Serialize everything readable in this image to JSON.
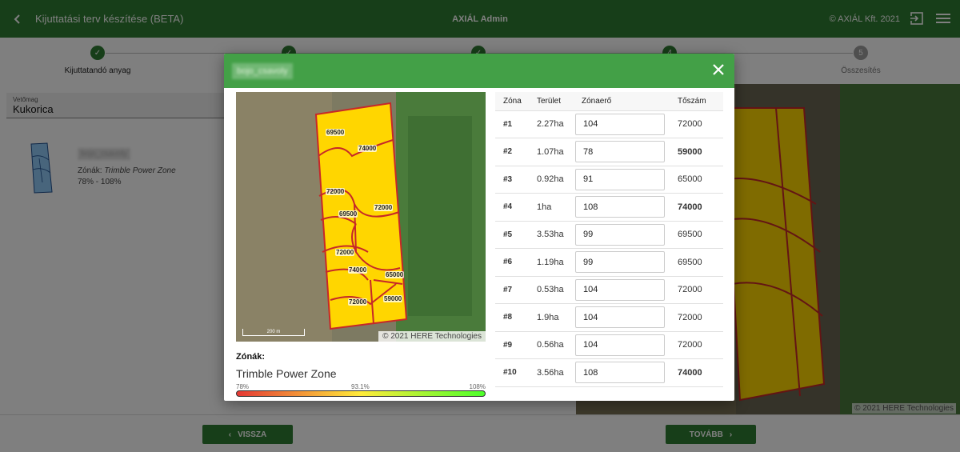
{
  "header": {
    "back_icon": "chevron-left-icon",
    "title": "Kijuttatási terv készítése (BETA)",
    "center_title": "AXIÁL Admin",
    "copyright": "© AXIÁL Kft. 2021",
    "exit_icon": "logout-icon",
    "menu_icon": "hamburger-menu-icon"
  },
  "stepper": {
    "steps": [
      {
        "label": "Kijuttatandó anyag",
        "state": "done",
        "mark": "✓"
      },
      {
        "label": "",
        "state": "done",
        "mark": "✓"
      },
      {
        "label": "",
        "state": "done",
        "mark": "✓"
      },
      {
        "label": "",
        "state": "current",
        "mark": "4"
      },
      {
        "label": "Összesítés",
        "state": "todo",
        "mark": "5"
      }
    ]
  },
  "page": {
    "seed_select": {
      "label": "Vetőmag",
      "value": "Kukorica"
    },
    "field": {
      "name": "bojo_csavoly",
      "zones_prefix": "Zónák:",
      "zone_type": "Trimble Power Zone",
      "range": "78% - 108%"
    },
    "map_copyright": "© 2021 HERE Technologies",
    "back_button": "VISSZA",
    "next_button": "TOVÁBB"
  },
  "modal": {
    "title": "bojo_csavoly",
    "close_icon": "close-icon",
    "map_copyright": "© 2021 HERE Technologies",
    "map_scale": "200 m",
    "zones_label": "Zónák:",
    "zone_type": "Trimble Power Zone",
    "scale": {
      "min": "78%",
      "mid": "93.1%",
      "max": "108%"
    },
    "columns": {
      "zone": "Zóna",
      "area": "Terület",
      "strength": "Zónaerő",
      "seed": "Tőszám"
    },
    "rows": [
      {
        "zone": "#1",
        "area": "2.27ha",
        "strength": "104",
        "seed": "72000",
        "status": "normal"
      },
      {
        "zone": "#2",
        "area": "1.07ha",
        "strength": "78",
        "seed": "59000",
        "status": "low"
      },
      {
        "zone": "#3",
        "area": "0.92ha",
        "strength": "91",
        "seed": "65000",
        "status": "normal"
      },
      {
        "zone": "#4",
        "area": "1ha",
        "strength": "108",
        "seed": "74000",
        "status": "high"
      },
      {
        "zone": "#5",
        "area": "3.53ha",
        "strength": "99",
        "seed": "69500",
        "status": "normal"
      },
      {
        "zone": "#6",
        "area": "1.19ha",
        "strength": "99",
        "seed": "69500",
        "status": "normal"
      },
      {
        "zone": "#7",
        "area": "0.53ha",
        "strength": "104",
        "seed": "72000",
        "status": "normal"
      },
      {
        "zone": "#8",
        "area": "1.9ha",
        "strength": "104",
        "seed": "72000",
        "status": "normal"
      },
      {
        "zone": "#9",
        "area": "0.56ha",
        "strength": "104",
        "seed": "72000",
        "status": "normal"
      },
      {
        "zone": "#10",
        "area": "3.56ha",
        "strength": "108",
        "seed": "74000",
        "status": "high"
      }
    ],
    "zone_labels": [
      "69500",
      "74000",
      "72000",
      "69500",
      "72000",
      "72000",
      "74000",
      "65000",
      "72000",
      "59000"
    ]
  },
  "colors": {
    "brand": "#2e7d32",
    "modal_header": "#43a047",
    "low": "#c62828",
    "high": "#43a047",
    "zone_fill": "#ffd600",
    "zone_border": "#c62828"
  }
}
